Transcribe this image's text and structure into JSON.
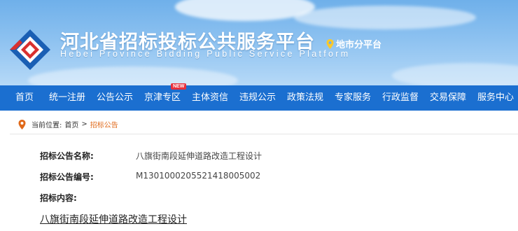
{
  "header": {
    "title": "河北省招标投标公共服务平台",
    "subtitle": "Hebei Province Bidding Public Service Platform",
    "city_link": "地市分平台",
    "colors": {
      "nav_bg": "#1b6fd0",
      "accent": "#e0691a",
      "logo_red": "#d8302f",
      "logo_blue": "#1a5fb4"
    }
  },
  "nav": {
    "items": [
      {
        "label": "首页"
      },
      {
        "label": "统一注册"
      },
      {
        "label": "公告公示"
      },
      {
        "label": "京津专区",
        "badge": "NEW"
      },
      {
        "label": "主体资信"
      },
      {
        "label": "违规公示"
      },
      {
        "label": "政策法规"
      },
      {
        "label": "专家服务"
      },
      {
        "label": "行政监督"
      },
      {
        "label": "交易保障"
      },
      {
        "label": "服务中心"
      }
    ]
  },
  "breadcrumb": {
    "prefix": "当前位置:",
    "home": "首页",
    "separator": ">",
    "current": "招标公告"
  },
  "notice": {
    "name_label": "招标公告名称:",
    "name_value": "八旗街南段延伸道路改造工程设计",
    "code_label": "招标公告编号:",
    "code_value": "M1301000205521418005002",
    "content_label": "招标内容:",
    "content_title": "八旗街南段延伸道路改造工程设计"
  }
}
